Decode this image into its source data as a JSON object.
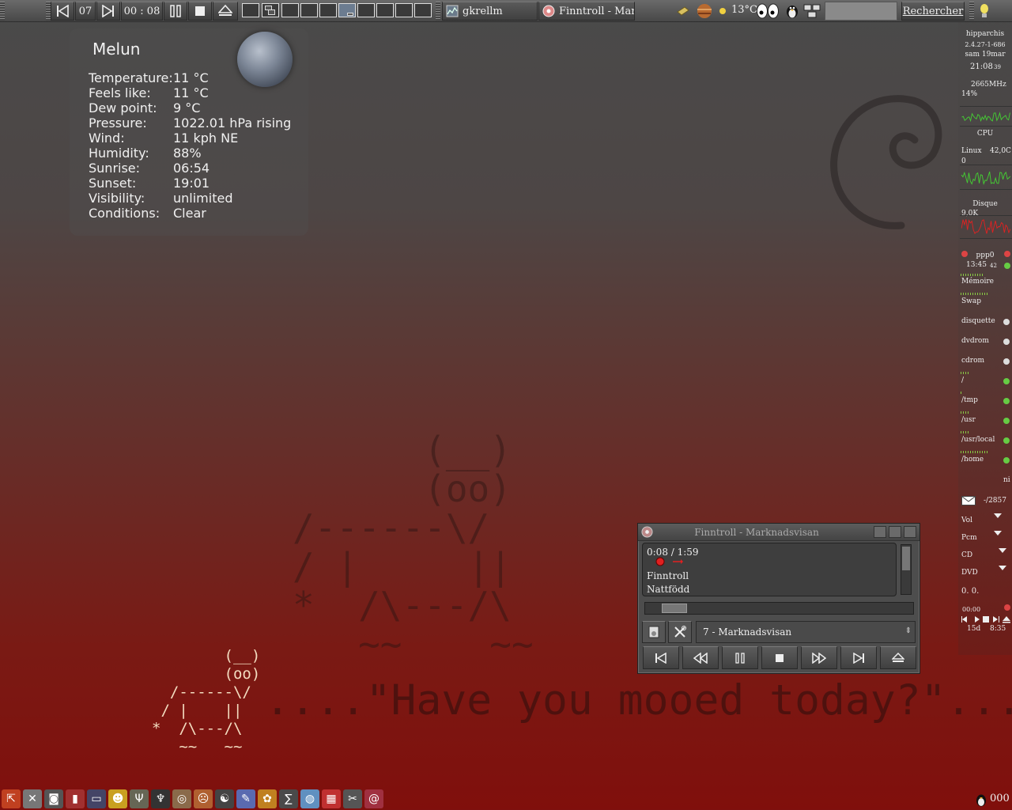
{
  "top_panel": {
    "track_number": "07",
    "elapsed": "00 : 08",
    "tasks": [
      {
        "label": "gkrellm"
      },
      {
        "label": "Finntroll - Mar"
      }
    ],
    "temperature": "13°C",
    "search_placeholder": "",
    "search_button": "Rechercher"
  },
  "weather": {
    "city": "Melun",
    "rows": [
      {
        "k": "Temperature:",
        "v": "11 °C"
      },
      {
        "k": "Feels like:",
        "v": "11 °C"
      },
      {
        "k": "Dew point:",
        "v": "9 °C"
      },
      {
        "k": "Pressure:",
        "v": "1022.01 hPa rising"
      },
      {
        "k": "Wind:",
        "v": "11 kph NE"
      },
      {
        "k": "Humidity:",
        "v": "88%"
      },
      {
        "k": "Sunrise:",
        "v": "06:54"
      },
      {
        "k": "Sunset:",
        "v": "19:01"
      },
      {
        "k": "Visibility:",
        "v": "unlimited"
      },
      {
        "k": "Conditions:",
        "v": "Clear"
      }
    ]
  },
  "wallpaper": {
    "big_cow": "      (__)\n      (oo)\n/------\\/\n/ |     ||\n*  /\\---/\\\n   ~~    ~~",
    "tagline": "....\"Have you mooed today?\"...",
    "small_cow": "        (__)\n        (oo)\n  /------\\/\n / |    ||\n*  /\\---/\\\n   ~~   ~~"
  },
  "gkrellm": {
    "hostname": "hipparchis",
    "kernel": "2.4.27-1-686",
    "date": "sam 19mar",
    "time": "21:08",
    "seconds": "39",
    "cpu_mhz": "2665MHz",
    "cpu_pct": "14%",
    "cpu_label": "CPU",
    "sensor_label": "Linux",
    "sensor_temp": "42,0C",
    "proc_count": "0",
    "disk_label": "Disque",
    "disk_rate": "9,0K",
    "net_label": "ppp0",
    "net_time": "13:45",
    "net_time_small": "42",
    "mem_label": "Mémoire",
    "swap_label": "Swap",
    "mounts": [
      "disquette",
      "dvdrom",
      "cdrom",
      "/",
      "/tmp",
      "/usr",
      "/usr/local",
      "/home"
    ],
    "ni": "ni",
    "mail_count": "-/2857",
    "mixer": [
      "Vol",
      "Pcm",
      "CD",
      "DVD"
    ],
    "mix_values": "0. 0.",
    "player_time": "00:00",
    "uptime_days": "15d",
    "uptime_time": "8:35",
    "colors": {
      "cpu": "#44cc33",
      "disk": "#dd2222",
      "led_green": "#66cc44",
      "led_red": "#dd4444"
    }
  },
  "player": {
    "title": "Finntroll - Marknadsvisan",
    "position": "0:08 / 1:59",
    "artist": "Finntroll",
    "album": "Nattfödd",
    "track": "7 - Marknadsvisan",
    "seek_fraction": 0.07
  },
  "tray": {
    "clock": "000"
  }
}
